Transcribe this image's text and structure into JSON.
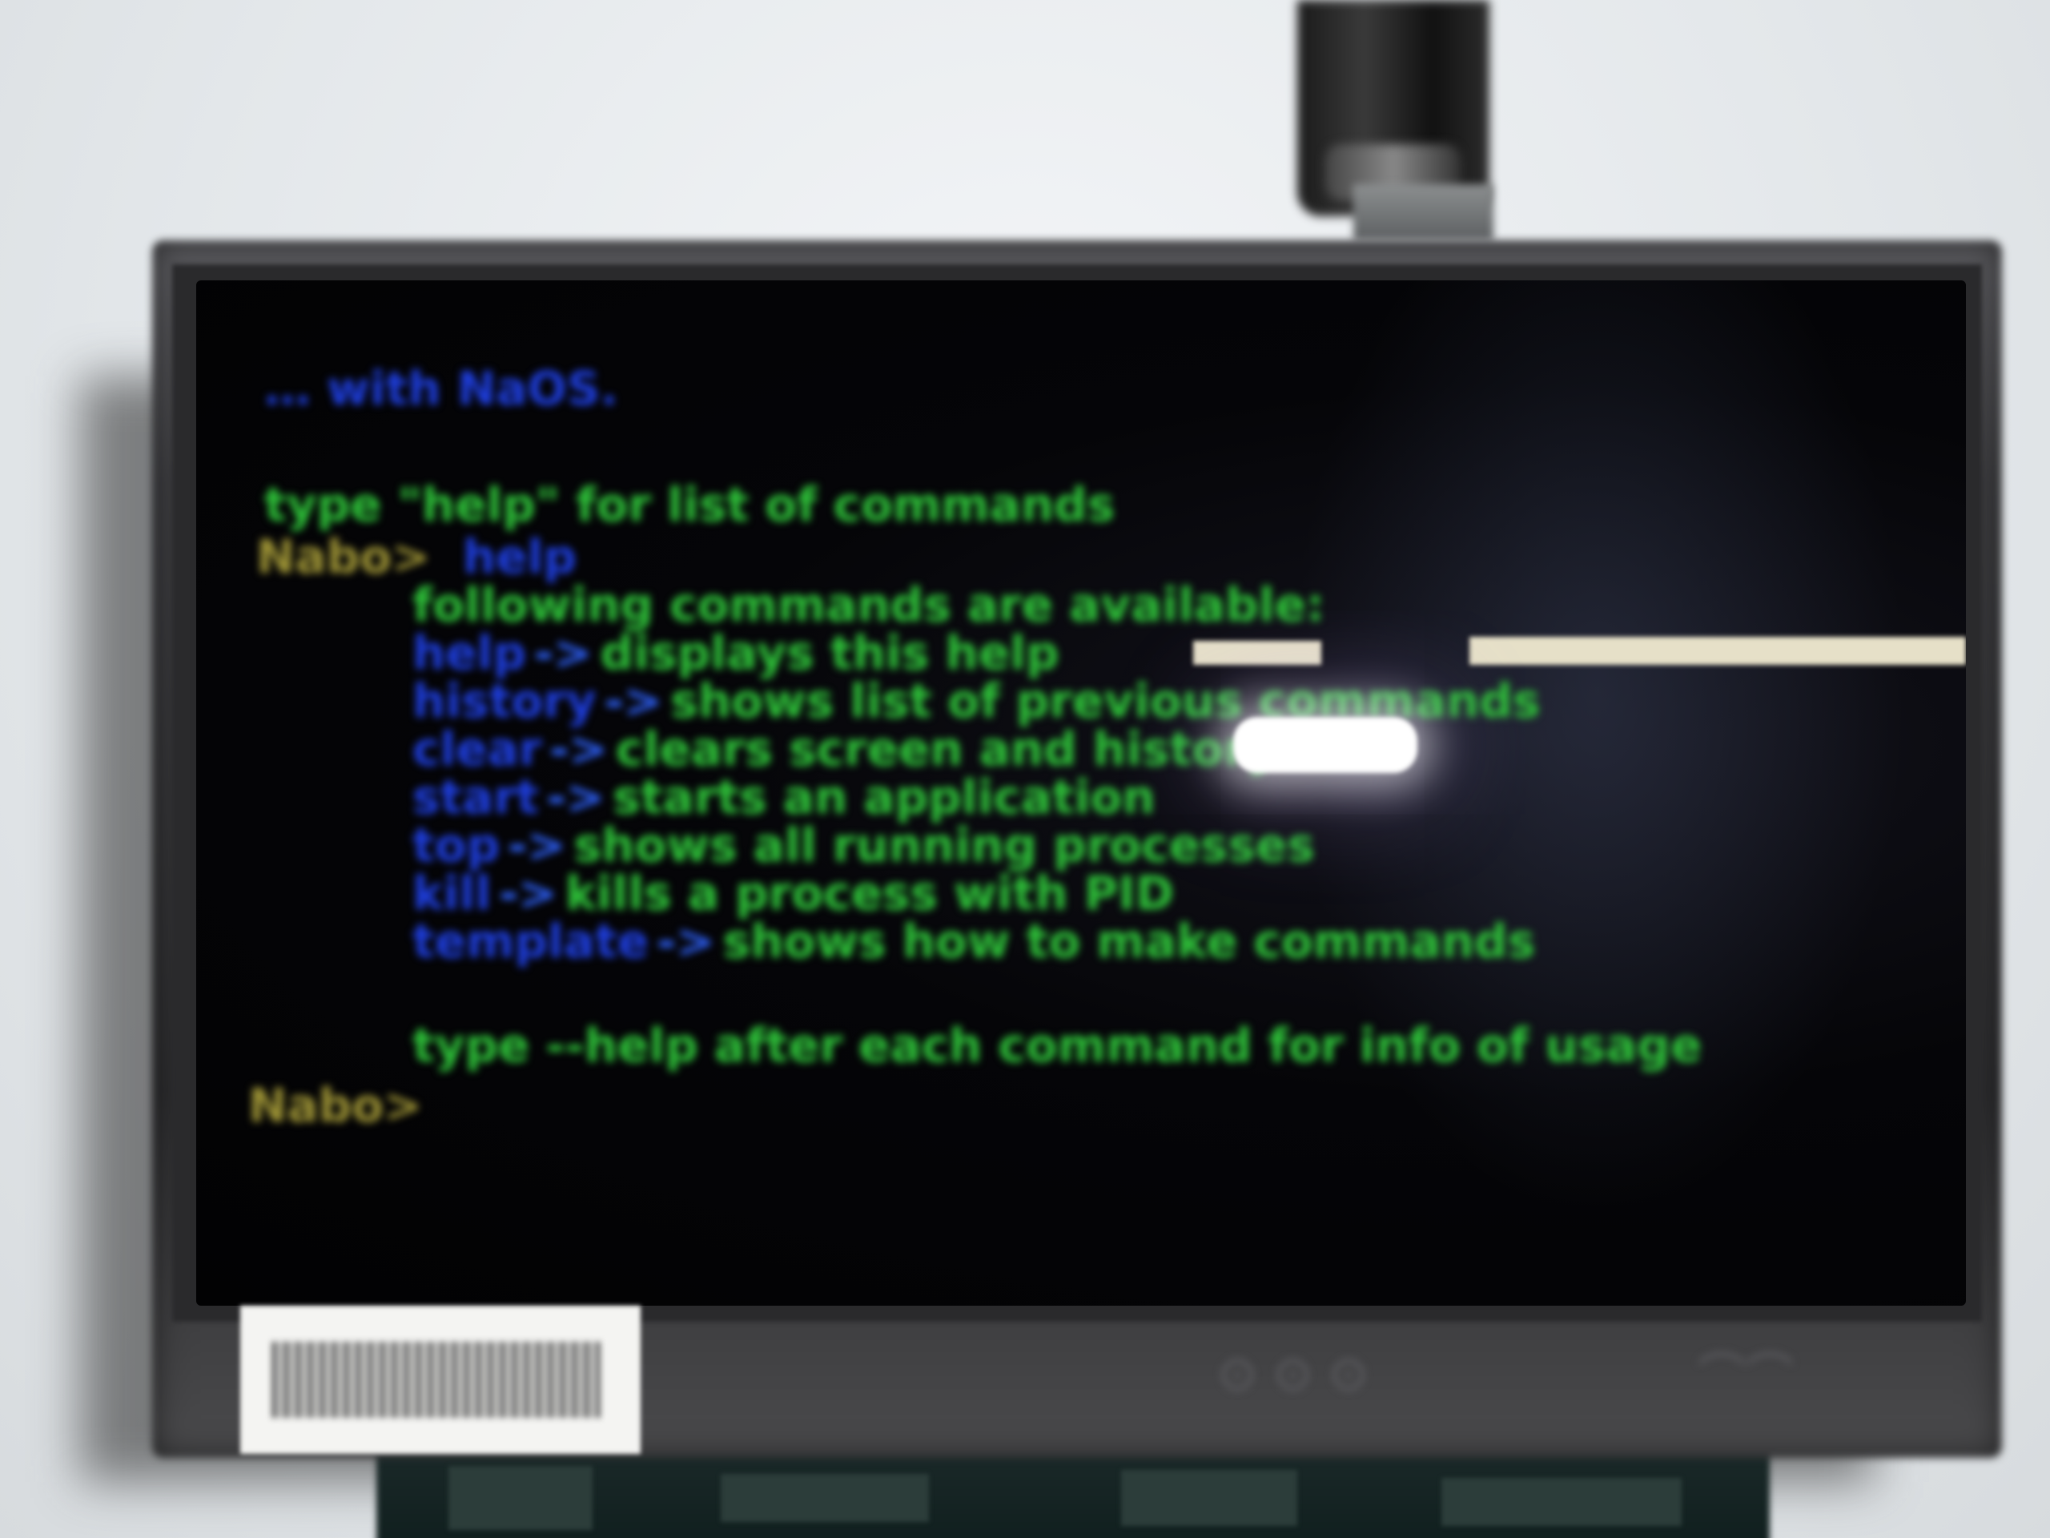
{
  "terminal": {
    "welcome_line": "… with NaOS.",
    "hint_line": "type \"help\" for list of commands",
    "prompt": "Nabo>",
    "command": "help",
    "help_intro": "following commands are available:",
    "commands": [
      {
        "name": "help",
        "arrow": "->",
        "desc": "displays this help"
      },
      {
        "name": "history",
        "arrow": "->",
        "desc": "shows list of previous commands"
      },
      {
        "name": "clear",
        "arrow": "->",
        "desc": "clears screen and history"
      },
      {
        "name": "start",
        "arrow": "->",
        "desc": "starts an application"
      },
      {
        "name": "top",
        "arrow": "->",
        "desc": "shows all running processes"
      },
      {
        "name": "kill",
        "arrow": "->",
        "desc": "kills a process with PID"
      },
      {
        "name": "template",
        "arrow": "->",
        "desc": "shows how to make commands"
      }
    ],
    "usage_line": "type --help after each command for info of usage",
    "prompt_final": "Nabo>"
  },
  "colors": {
    "command_blue": "#1f3fe0",
    "text_green": "#2fc43a",
    "prompt_yellow": "#9e9436",
    "screen_black": "#050508"
  },
  "icons": [
    "barcode-sticker",
    "power-cable"
  ]
}
